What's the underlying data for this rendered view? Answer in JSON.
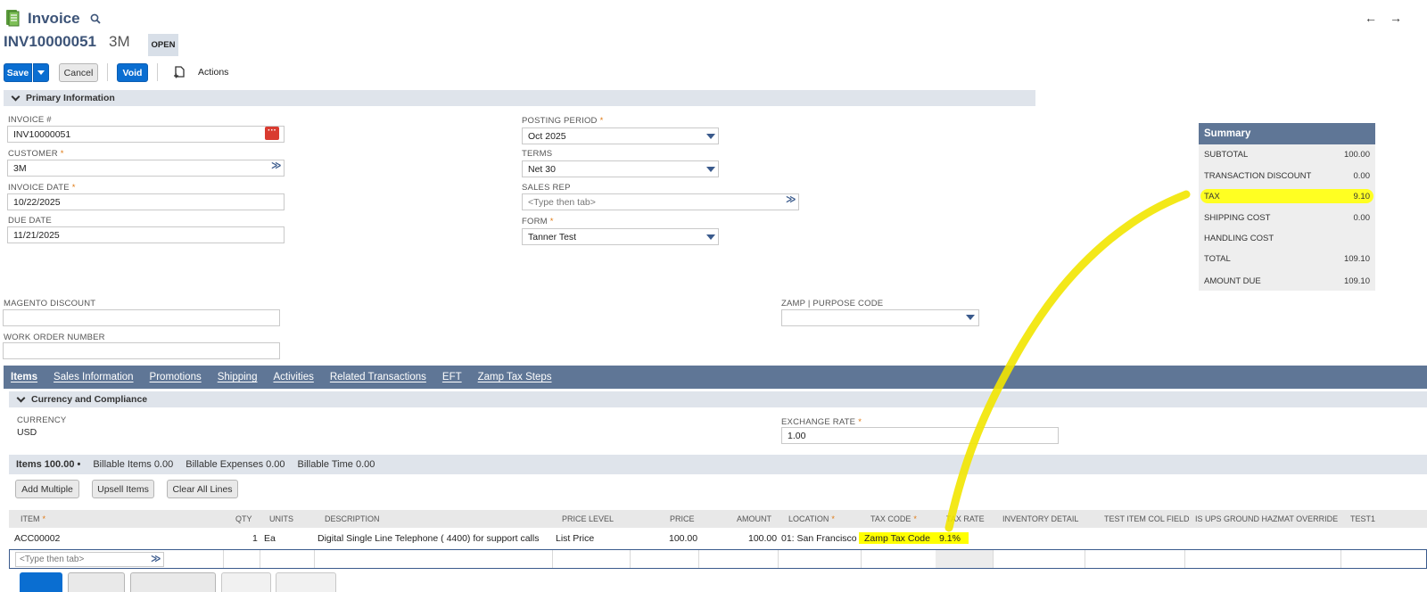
{
  "header": {
    "record_type": "Invoice",
    "record_id": "INV10000051",
    "customer_short": "3M",
    "status": "OPEN",
    "nav_back": "←",
    "nav_forward": "→"
  },
  "toolbar": {
    "save": "Save",
    "cancel": "Cancel",
    "void": "Void",
    "actions": "Actions"
  },
  "primary": {
    "section_title": "Primary Information",
    "invoice_no": {
      "label": "INVOICE #",
      "value": "INV10000051"
    },
    "customer": {
      "label": "CUSTOMER",
      "value": "3M"
    },
    "invoice_date": {
      "label": "INVOICE DATE",
      "value": "10/22/2025"
    },
    "due_date": {
      "label": "DUE DATE",
      "value": "11/21/2025"
    },
    "posting_period": {
      "label": "POSTING PERIOD",
      "value": "Oct 2025"
    },
    "terms": {
      "label": "TERMS",
      "value": "Net 30"
    },
    "sales_rep": {
      "label": "SALES REP",
      "placeholder": "<Type then tab>"
    },
    "form": {
      "label": "FORM",
      "value": "Tanner Test"
    },
    "magento_discount": {
      "label": "MAGENTO DISCOUNT",
      "value": ""
    },
    "work_order": {
      "label": "WORK ORDER NUMBER",
      "value": ""
    },
    "zamp_purpose": {
      "label": "ZAMP | PURPOSE CODE",
      "value": ""
    }
  },
  "summary": {
    "title": "Summary",
    "rows": [
      {
        "label": "SUBTOTAL",
        "value": "100.00"
      },
      {
        "label": "TRANSACTION DISCOUNT",
        "value": "0.00"
      },
      {
        "label": "TAX",
        "value": "9.10"
      },
      {
        "label": "SHIPPING COST",
        "value": "0.00"
      },
      {
        "label": "HANDLING COST",
        "value": ""
      },
      {
        "label": "TOTAL",
        "value": "109.10"
      },
      {
        "label": "AMOUNT DUE",
        "value": "109.10"
      }
    ]
  },
  "tabs": [
    "Items",
    "Sales Information",
    "Promotions",
    "Shipping",
    "Activities",
    "Related Transactions",
    "EFT",
    "Zamp Tax Steps"
  ],
  "currency_section": {
    "title": "Currency and Compliance",
    "currency_label": "CURRENCY",
    "currency_value": "USD",
    "exchange_label": "EXCHANGE RATE",
    "exchange_value": "1.00"
  },
  "subtabs": [
    "Items 100.00 •",
    "Billable Items 0.00",
    "Billable Expenses 0.00",
    "Billable Time 0.00"
  ],
  "item_buttons": [
    "Add Multiple",
    "Upsell Items",
    "Clear All Lines"
  ],
  "columns": [
    "ITEM",
    "QTY",
    "UNITS",
    "DESCRIPTION",
    "PRICE LEVEL",
    "PRICE",
    "AMOUNT",
    "LOCATION",
    "TAX CODE",
    "TAX RATE",
    "INVENTORY DETAIL",
    "TEST ITEM COL FIELD",
    "IS UPS GROUND HAZMAT OVERRIDE",
    "TEST1"
  ],
  "line": {
    "item": "ACC00002",
    "qty": "1",
    "units": "Ea",
    "description": "Digital Single Line Telephone ( 4400) for support calls",
    "price_level": "List Price",
    "price": "100.00",
    "amount": "100.00",
    "location": "01: San Francisco",
    "tax_code": "Zamp Tax Code",
    "tax_rate": "9.1%"
  },
  "new_line_placeholder": "<Type then tab>",
  "colors": {
    "accent": "#0a6ed1",
    "header": "#5f7696",
    "highlight": "#ffff00"
  }
}
